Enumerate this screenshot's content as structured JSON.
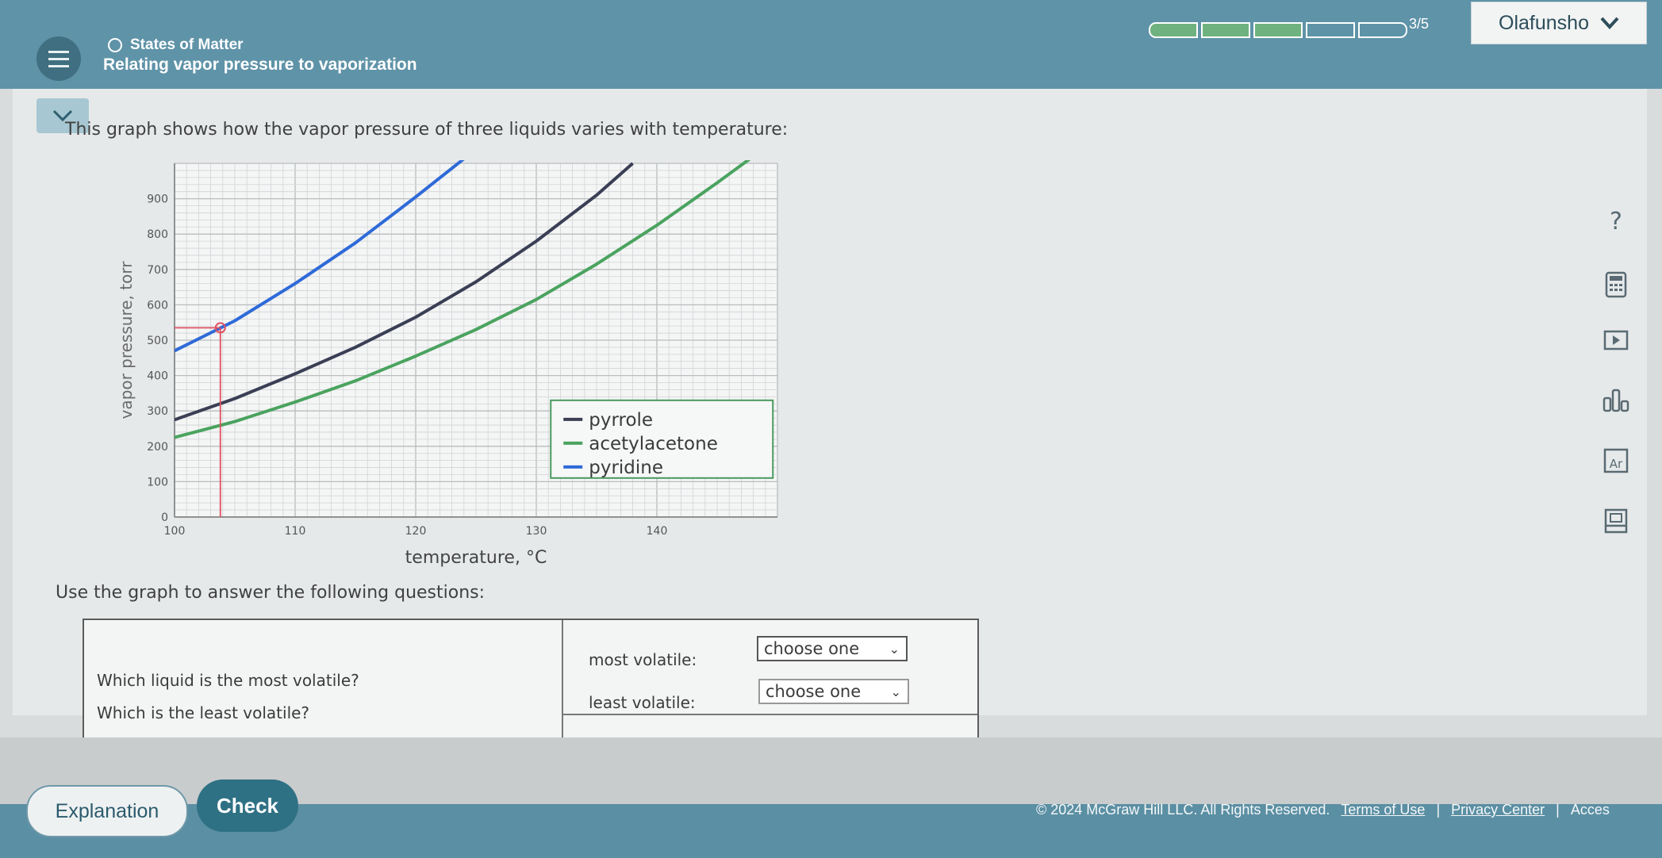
{
  "header": {
    "topic": "States of Matter",
    "title": "Relating vapor pressure to vaporization",
    "progress_text": "3/5",
    "progress": {
      "completed": 3,
      "total": 5
    },
    "user": "Olafunsho"
  },
  "intro": "This graph shows how the vapor pressure of three liquids varies with temperature:",
  "chart_data": {
    "type": "line",
    "xlabel": "temperature,  °C",
    "ylabel": "vapor pressure, torr",
    "xlim": [
      100,
      150
    ],
    "ylim": [
      0,
      1000
    ],
    "x_ticks": [
      "100",
      "110",
      "120",
      "130",
      "140"
    ],
    "y_ticks": [
      "0",
      "100",
      "200",
      "300",
      "400",
      "500",
      "600",
      "700",
      "800",
      "900"
    ],
    "grid": true,
    "legend_position": "bottom-right",
    "series": [
      {
        "name": "pyrrole",
        "color": "#3a3f55",
        "x": [
          100,
          105,
          110,
          115,
          120,
          125,
          130,
          135,
          138
        ],
        "y": [
          275,
          335,
          405,
          480,
          565,
          665,
          780,
          910,
          1000
        ]
      },
      {
        "name": "acetylacetone",
        "color": "#4aa35f",
        "x": [
          100,
          105,
          110,
          115,
          120,
          125,
          130,
          135,
          140,
          145,
          148
        ],
        "y": [
          225,
          270,
          325,
          385,
          455,
          530,
          615,
          715,
          825,
          945,
          1020
        ]
      },
      {
        "name": "pyridine",
        "color": "#2e6ad8",
        "x": [
          100,
          105,
          110,
          115,
          120,
          125
        ],
        "y": [
          470,
          555,
          660,
          775,
          905,
          1040
        ]
      }
    ],
    "marker": {
      "x": 103.8,
      "y": 535,
      "color": "#e05060"
    }
  },
  "questions_intro": "Use the graph to answer the following questions:",
  "questions": {
    "q1": "Which liquid is the most volatile?",
    "q2": "Which is the least volatile?",
    "most_label": "most volatile:",
    "least_label": "least volatile:",
    "most_value": "choose one",
    "least_value": "choose one"
  },
  "buttons": {
    "explanation": "Explanation",
    "check": "Check"
  },
  "footer": {
    "copyright": "© 2024 McGraw Hill LLC. All Rights Reserved.",
    "terms": "Terms of Use",
    "privacy": "Privacy Center",
    "access": "Acces"
  },
  "toolbar": {
    "help": "?",
    "icons": [
      "calculator-icon",
      "video-icon",
      "data-icon",
      "periodic-table-icon",
      "reference-icon"
    ],
    "periodic": "Ar"
  }
}
